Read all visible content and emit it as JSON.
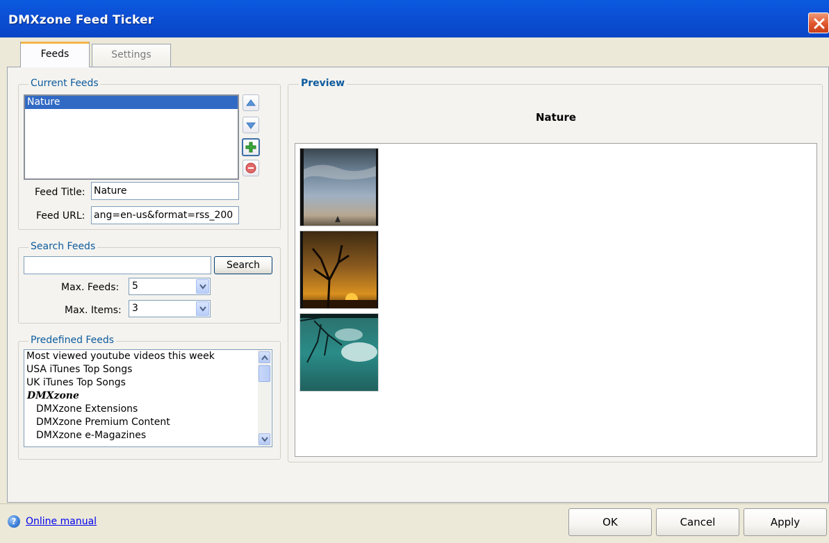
{
  "window": {
    "title": "DMXzone Feed Ticker"
  },
  "tabs": [
    {
      "label": "Feeds",
      "active": true
    },
    {
      "label": "Settings",
      "active": false
    }
  ],
  "current_feeds": {
    "legend": "Current Feeds",
    "items": [
      "Nature"
    ],
    "selected": "Nature",
    "feed_title_label": "Feed Title:",
    "feed_title_value": "Nature",
    "feed_url_label": "Feed URL:",
    "feed_url_value": "ang=en-us&format=rss_200"
  },
  "search_feeds": {
    "legend": "Search Feeds",
    "query": "",
    "search_button": "Search",
    "max_feeds_label": "Max. Feeds:",
    "max_feeds_value": "5",
    "max_items_label": "Max. Items:",
    "max_items_value": "3"
  },
  "predefined_feeds": {
    "legend": "Predefined Feeds",
    "items": [
      {
        "label": "Most viewed youtube videos this week",
        "style": "normal"
      },
      {
        "label": "USA iTunes Top Songs",
        "style": "normal"
      },
      {
        "label": "UK iTunes Top Songs",
        "style": "normal"
      },
      {
        "label": "DMXzone",
        "style": "group"
      },
      {
        "label": "DMXzone Extensions",
        "style": "child"
      },
      {
        "label": "DMXzone Premium Content",
        "style": "child"
      },
      {
        "label": "DMXzone e-Magazines",
        "style": "child"
      }
    ]
  },
  "preview": {
    "legend": "Preview",
    "feed_title": "Nature"
  },
  "footer": {
    "help_link": "Online manual",
    "ok": "OK",
    "cancel": "Cancel",
    "apply": "Apply"
  },
  "icons": {
    "up": "up-arrow-icon",
    "down": "down-arrow-icon",
    "add": "plus-icon",
    "remove": "minus-icon",
    "close": "close-icon",
    "help": "help-icon"
  },
  "colors": {
    "titlebar": "#0845c6",
    "selection": "#316ac5",
    "legend": "#0c5a9c"
  }
}
